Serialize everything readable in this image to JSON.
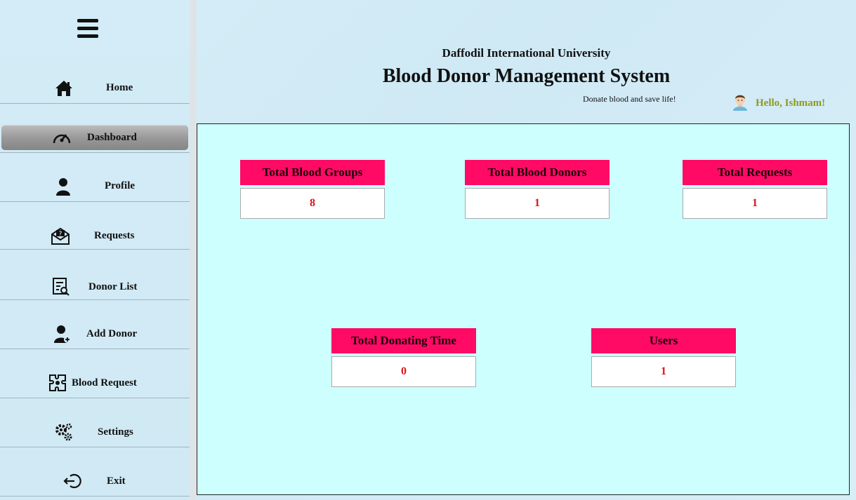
{
  "sidebar": {
    "menu_icon": "hamburger-icon",
    "items": [
      {
        "label": "Home",
        "icon": "home-icon"
      },
      {
        "label": "Dashboard",
        "icon": "speedometer-icon",
        "active": true
      },
      {
        "label": "Profile",
        "icon": "user-icon"
      },
      {
        "label": "Requests",
        "icon": "envelope-question-icon"
      },
      {
        "label": "Donor List",
        "icon": "list-search-icon"
      },
      {
        "label": "Add Donor",
        "icon": "user-plus-icon"
      },
      {
        "label": "Blood Request",
        "icon": "puzzle-icon"
      },
      {
        "label": "Settings",
        "icon": "gears-icon"
      },
      {
        "label": "Exit",
        "icon": "exit-icon"
      }
    ]
  },
  "header": {
    "university": "Daffodil International University",
    "title": "Blood Donor Management System",
    "tagline": "Donate blood and save life!",
    "greeting": "Hello, Ishmam!"
  },
  "cards": [
    {
      "title": "Total Blood Groups",
      "value": "8"
    },
    {
      "title": "Total Blood Donors",
      "value": "1"
    },
    {
      "title": "Total Requests",
      "value": "1"
    },
    {
      "title": "Total Donating Time",
      "value": "0"
    },
    {
      "title": "Users",
      "value": "1"
    }
  ],
  "colors": {
    "card_header": "#ff0a65",
    "card_value_text": "#e0121a",
    "main_bg": "#ccfffe",
    "greeting_text": "#8e9a1c"
  }
}
